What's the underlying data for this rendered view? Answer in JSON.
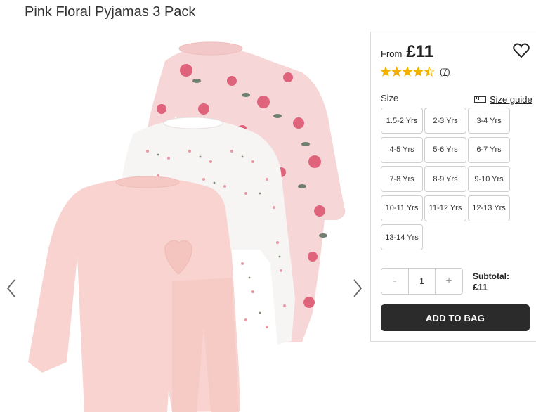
{
  "product": {
    "title": "Pink Floral Pyjamas 3 Pack"
  },
  "gallery": {
    "prev_icon": "chevron-left-icon",
    "next_icon": "chevron-right-icon"
  },
  "pricing": {
    "from_label": "From",
    "price": "£11"
  },
  "wishlist": {
    "icon": "heart-outline-icon"
  },
  "rating": {
    "stars": 4.5,
    "max_stars": 5,
    "review_count": "(7)",
    "star_color": "#f2b100"
  },
  "size": {
    "label": "Size",
    "guide_label": "Size guide",
    "options": [
      "1.5-2 Yrs",
      "2-3 Yrs",
      "3-4 Yrs",
      "4-5 Yrs",
      "5-6 Yrs",
      "6-7 Yrs",
      "7-8 Yrs",
      "8-9 Yrs",
      "9-10 Yrs",
      "10-11 Yrs",
      "11-12 Yrs",
      "12-13 Yrs",
      "13-14 Yrs"
    ]
  },
  "quantity": {
    "minus": "-",
    "value": "1",
    "plus": "+"
  },
  "subtotal": {
    "label": "Subtotal:",
    "value": "£11"
  },
  "cta": {
    "add_to_bag": "ADD TO BAG",
    "color": "#2b2b2b"
  }
}
